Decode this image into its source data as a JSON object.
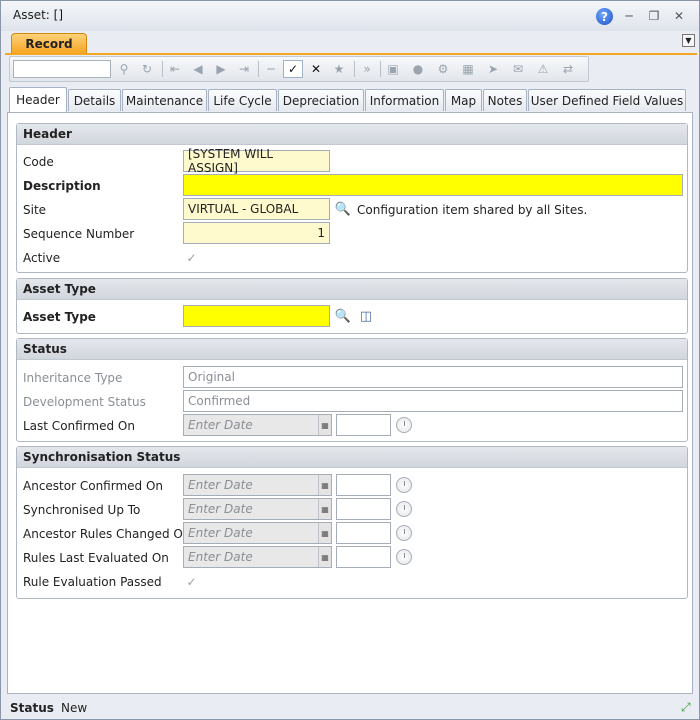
{
  "window": {
    "title": "Asset: []"
  },
  "record_tab": {
    "label": "Record"
  },
  "toolbar": {
    "search_value": "",
    "icons": [
      "search-icon",
      "refresh-icon",
      "first-icon",
      "previous-icon",
      "next-icon",
      "last-icon",
      "delete-icon",
      "save-icon",
      "cancel-icon",
      "add-icon",
      "more-icon",
      "window-icon",
      "globe-icon",
      "gear-icon",
      "erase-icon",
      "import-icon",
      "mail-icon",
      "warning-icon",
      "swap-icon"
    ]
  },
  "tabs": [
    "Header",
    "Details",
    "Maintenance",
    "Life Cycle",
    "Depreciation",
    "Information",
    "Map",
    "Notes",
    "User Defined Field Values"
  ],
  "header": {
    "title": "Header",
    "code_label": "Code",
    "code_value": "[SYSTEM WILL ASSIGN]",
    "description_label": "Description",
    "description_value": "",
    "site_label": "Site",
    "site_value": "VIRTUAL - GLOBAL",
    "site_note": "Configuration item shared by all Sites.",
    "sequence_label": "Sequence Number",
    "sequence_value": "1",
    "active_label": "Active"
  },
  "asset_type": {
    "title": "Asset Type",
    "label": "Asset Type",
    "value": ""
  },
  "status_section": {
    "title": "Status",
    "inheritance_label": "Inheritance Type",
    "inheritance_value": "Original",
    "development_label": "Development Status",
    "development_value": "Confirmed",
    "last_confirmed_label": "Last Confirmed On",
    "date_placeholder": "Enter Date"
  },
  "sync": {
    "title": "Synchronisation Status",
    "ancestor_confirmed_label": "Ancestor Confirmed On",
    "synchronised_label": "Synchronised Up To",
    "ancestor_rules_label": "Ancestor Rules Changed On",
    "rules_evaluated_label": "Rules Last Evaluated On",
    "rule_passed_label": "Rule Evaluation Passed",
    "date_placeholder": "Enter Date"
  },
  "statusbar": {
    "label": "Status",
    "value": "New"
  },
  "colors": {
    "required": "#ffff00",
    "pale": "#fffacd",
    "accent": "#f5a623"
  }
}
